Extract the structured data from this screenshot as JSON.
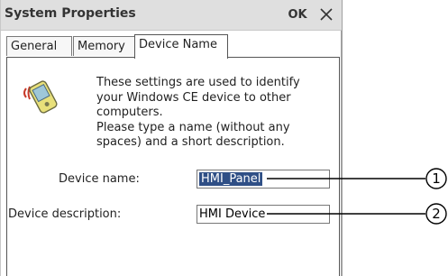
{
  "window": {
    "title": "System Properties",
    "ok_label": "OK",
    "close_icon": "close-icon"
  },
  "tabs": [
    {
      "label": "General",
      "active": false
    },
    {
      "label": "Memory",
      "active": false
    },
    {
      "label": "Device Name",
      "active": true
    }
  ],
  "info": {
    "lines": [
      "These settings are used to identify",
      "your Windows CE device to other",
      "computers.",
      "Please type a name (without any",
      "spaces) and a short description."
    ],
    "icon": "device-icon"
  },
  "form": {
    "device_name_label": "Device name:",
    "device_name_value": "HMI_Panel",
    "device_description_label": "Device description:",
    "device_description_value": "HMI Device"
  },
  "callouts": [
    "1",
    "2"
  ],
  "colors": {
    "titlebar": "#dfdfdf",
    "selection": "#2f4f86",
    "window_bg": "#ffffff"
  }
}
